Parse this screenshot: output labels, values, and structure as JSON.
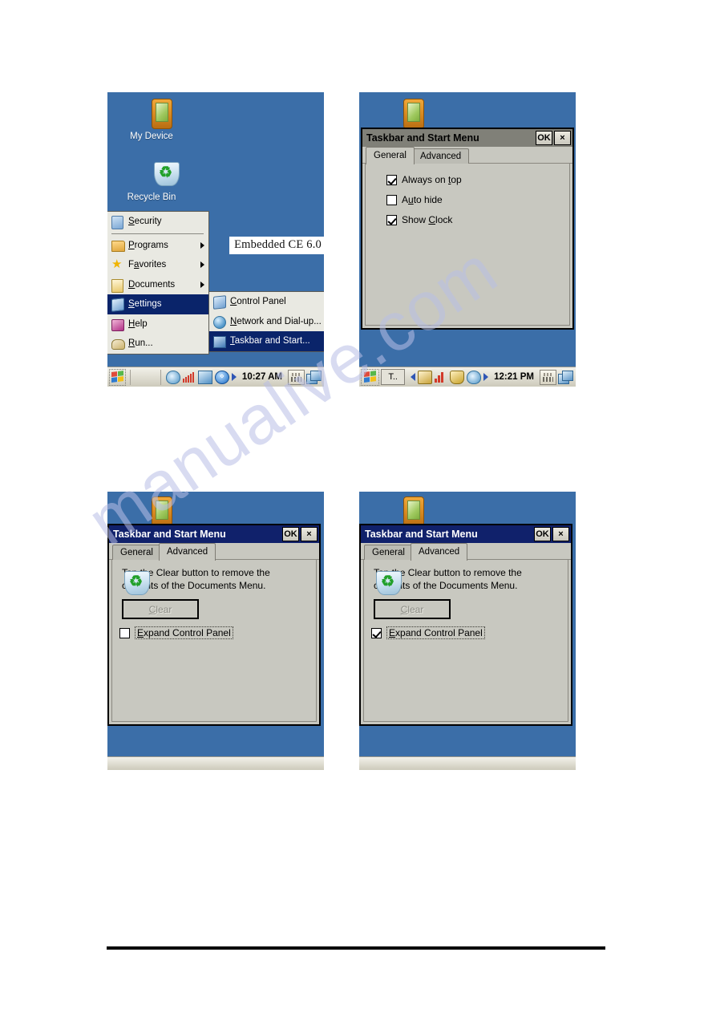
{
  "desktop": {
    "icons": [
      {
        "name": "my-device",
        "label": "My Device"
      },
      {
        "name": "recycle-bin",
        "label": "Recycle Bin"
      }
    ],
    "banner": "Embedded CE 6.0"
  },
  "start_menu": {
    "items": [
      {
        "label": "Security",
        "accel": "S",
        "icon": "security-icon",
        "has_submenu": false,
        "selected": false
      },
      {
        "label": "Programs",
        "accel": "P",
        "icon": "programs-icon",
        "has_submenu": true,
        "selected": false
      },
      {
        "label": "Favorites",
        "accel": "a",
        "icon": "favorites-icon",
        "has_submenu": true,
        "selected": false
      },
      {
        "label": "Documents",
        "accel": "D",
        "icon": "documents-icon",
        "has_submenu": true,
        "selected": false
      },
      {
        "label": "Settings",
        "accel": "S",
        "icon": "settings-icon",
        "has_submenu": false,
        "selected": true
      },
      {
        "label": "Help",
        "accel": "H",
        "icon": "help-icon",
        "has_submenu": false,
        "selected": false
      },
      {
        "label": "Run...",
        "accel": "R",
        "icon": "run-icon",
        "has_submenu": false,
        "selected": false
      }
    ],
    "submenu": {
      "items": [
        {
          "label": "Control Panel",
          "accel": "C",
          "icon": "control-panel-icon",
          "selected": false
        },
        {
          "label": "Network and Dial-up...",
          "accel": "N",
          "icon": "network-icon",
          "selected": false
        },
        {
          "label": "Taskbar and Start...",
          "accel": "T",
          "icon": "taskbar-icon",
          "selected": true
        }
      ]
    }
  },
  "taskbars": {
    "panel1": {
      "clock": "10:27 AM",
      "task_button": ""
    },
    "panel2": {
      "clock": "12:21 PM",
      "task_button": "T.."
    }
  },
  "dialog": {
    "title": "Taskbar and Start Menu",
    "ok_label": "OK",
    "close_label": "×",
    "tabs": [
      {
        "label": "General"
      },
      {
        "label": "Advanced"
      }
    ],
    "general": {
      "checkboxes": [
        {
          "label": "Always on top",
          "checked": true
        },
        {
          "label": "Auto hide",
          "checked": false
        },
        {
          "label": "Show Clock",
          "checked": true
        }
      ]
    },
    "advanced": {
      "description": "Tap the Clear button to remove the contents of the Documents Menu.",
      "clear_button": "Clear",
      "expand_checkbox": {
        "label": "Expand Control Panel",
        "checked_left": false,
        "checked_right": true
      }
    }
  },
  "watermark": {
    "text": "manualive.com"
  },
  "colors": {
    "desktop_blue": "#3b6ea8",
    "title_active": "#10216b",
    "title_inactive": "#808078",
    "dialog_face": "#c8c8c0",
    "menu_face": "#e9e9e2",
    "menu_highlight": "#0a246a"
  }
}
